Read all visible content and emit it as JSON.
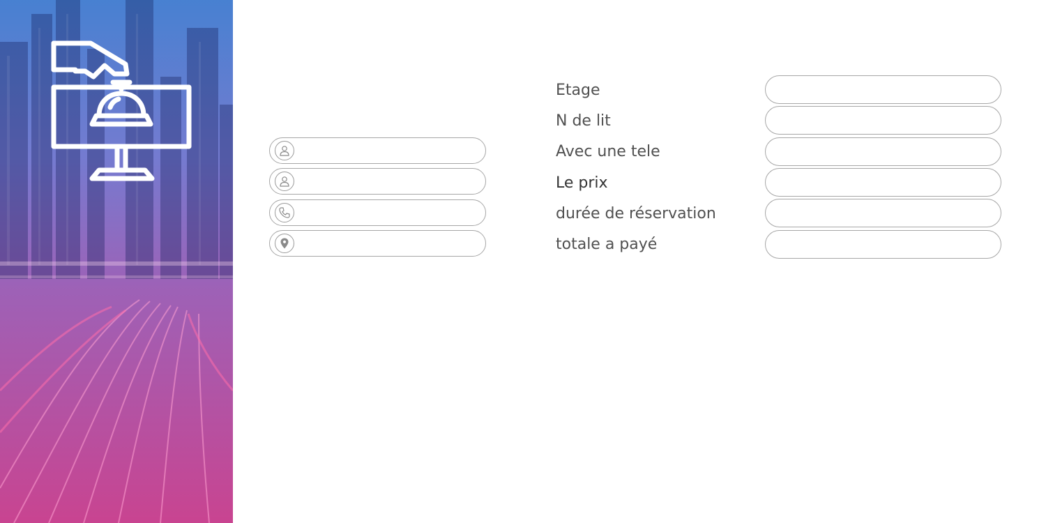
{
  "form": {
    "left_fields": [
      {
        "icon": "user-icon",
        "value": ""
      },
      {
        "icon": "user-icon",
        "value": ""
      },
      {
        "icon": "phone-icon",
        "value": ""
      },
      {
        "icon": "location-pin-icon",
        "value": ""
      }
    ],
    "labels": {
      "etage": "Etage",
      "n_de_lit": "N de lit",
      "avec_une_tele": "Avec une tele",
      "le_prix": "Le prix",
      "duree": "durée de réservation",
      "totale": "totale a payé"
    },
    "right_fields": {
      "etage": "",
      "n_de_lit": "",
      "avec_une_tele": "",
      "le_prix": "",
      "duree": "",
      "totale": ""
    }
  },
  "side_panel": {
    "logo_icon": "reception-bell-icon",
    "gradient_top": "#3876cd",
    "gradient_bottom": "#c43487"
  }
}
